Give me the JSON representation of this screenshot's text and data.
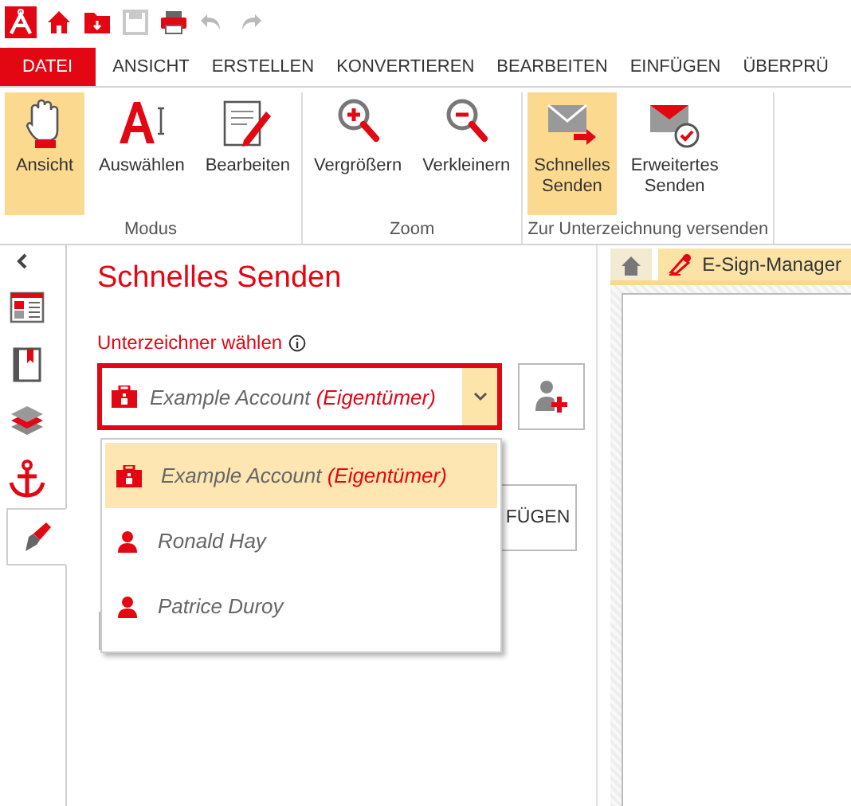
{
  "quick_access": [
    {
      "kind": "logo"
    },
    {
      "kind": "home"
    },
    {
      "kind": "folder"
    },
    {
      "kind": "save",
      "disabled": true
    },
    {
      "kind": "print"
    },
    {
      "kind": "undo",
      "disabled": true
    },
    {
      "kind": "redo",
      "disabled": true
    }
  ],
  "menu_tabs": [
    {
      "label": "DATEI",
      "kind": "file"
    },
    {
      "label": "ANSICHT",
      "kind": "tab"
    },
    {
      "label": "ERSTELLEN",
      "kind": "tab"
    },
    {
      "label": "KONVERTIEREN",
      "kind": "tab"
    },
    {
      "label": "BEARBEITEN",
      "kind": "tab"
    },
    {
      "label": "EINFÜGEN",
      "kind": "tab"
    },
    {
      "label": "ÜBERPRÜ",
      "kind": "tab"
    }
  ],
  "ribbon": {
    "groups": [
      {
        "label": "Modus",
        "buttons": [
          {
            "label": "Ansicht",
            "kind": "hand",
            "selected": true
          },
          {
            "label": "Auswählen",
            "kind": "select",
            "selected": false
          },
          {
            "label": "Bearbeiten",
            "kind": "edit",
            "selected": false
          }
        ]
      },
      {
        "label": "Zoom",
        "buttons": [
          {
            "label": "Vergrößern",
            "kind": "zoom-in",
            "selected": false
          },
          {
            "label": "Verkleinern",
            "kind": "zoom-out",
            "selected": false
          }
        ]
      },
      {
        "label": "Zur Unterzeichnung versenden",
        "buttons": [
          {
            "label": "Schnelles Senden",
            "kind": "send",
            "selected": true
          },
          {
            "label": "Erweitertes Senden",
            "kind": "send-check",
            "selected": false
          }
        ]
      }
    ]
  },
  "sidebar": {
    "items": [
      {
        "kind": "pages",
        "selected": false
      },
      {
        "kind": "bookmark",
        "selected": false
      },
      {
        "kind": "layers",
        "selected": false
      },
      {
        "kind": "anchor",
        "selected": false
      },
      {
        "kind": "signature",
        "selected": true
      }
    ]
  },
  "panel": {
    "title": "Schnelles Senden",
    "signer_label": "Unterzeichner wählen",
    "signer_select": {
      "value": "Example Account",
      "role": "(Eigentümer)",
      "expanded": true
    },
    "options": [
      {
        "name": "Example Account",
        "role": "(Eigentümer)",
        "kind": "account",
        "selected": true
      },
      {
        "name": "Ronald Hay",
        "kind": "person",
        "selected": false
      },
      {
        "name": "Patrice Duroy",
        "kind": "person",
        "selected": false
      }
    ],
    "add_button_label": "FÜGEN"
  },
  "document_tabs": [
    {
      "kind": "home",
      "selected": false
    },
    {
      "kind": "esign",
      "label": "E-Sign-Manager",
      "selected": true
    }
  ]
}
